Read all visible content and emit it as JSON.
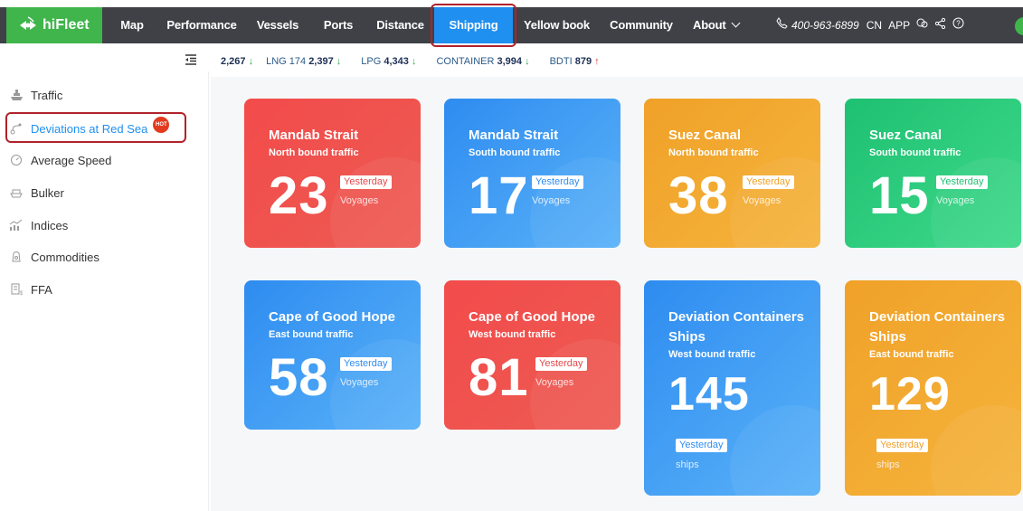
{
  "app": {
    "logo_text": "hiFleet"
  },
  "nav": {
    "items": [
      {
        "label": "Map"
      },
      {
        "label": "Performance"
      },
      {
        "label": "Vessels"
      },
      {
        "label": "Ports"
      },
      {
        "label": "Distance"
      },
      {
        "label": "Shipping"
      },
      {
        "label": "Yellow book"
      },
      {
        "label": "Community"
      },
      {
        "label": "About"
      }
    ],
    "active": "Shipping",
    "phone": "400-963-6899",
    "lang": "CN",
    "app_label": "APP"
  },
  "ticker": [
    {
      "label": "",
      "value": "2,267",
      "dir": "down"
    },
    {
      "label": "LNG 174",
      "value": "2,397",
      "dir": "down"
    },
    {
      "label": "LPG",
      "value": "4,343",
      "dir": "down"
    },
    {
      "label": "CONTAINER",
      "value": "3,994",
      "dir": "down"
    },
    {
      "label": "BDTI",
      "value": "879",
      "dir": "up"
    }
  ],
  "sidebar": {
    "items": [
      {
        "label": "Traffic",
        "icon": "ship-icon"
      },
      {
        "label": "Deviations at Red Sea",
        "icon": "route-icon",
        "badge": "HOT"
      },
      {
        "label": "Average Speed",
        "icon": "speedometer-icon"
      },
      {
        "label": "Bulker",
        "icon": "bulker-icon"
      },
      {
        "label": "Indices",
        "icon": "chart-icon"
      },
      {
        "label": "Commodities",
        "icon": "commodities-icon"
      },
      {
        "label": "FFA",
        "icon": "ffa-icon"
      }
    ],
    "active": "Deviations at Red Sea"
  },
  "cards": [
    {
      "title": "Mandab Strait",
      "subtitle": "North bound traffic",
      "value": "23",
      "tag": "Yesterday",
      "unit": "Voyages",
      "color": "#f24b4b"
    },
    {
      "title": "Mandab Strait",
      "subtitle": "South bound traffic",
      "value": "17",
      "tag": "Yesterday",
      "unit": "Voyages",
      "color": "#2e8cf0"
    },
    {
      "title": "Suez Canal",
      "subtitle": "North bound traffic",
      "value": "38",
      "tag": "Yesterday",
      "unit": "Voyages",
      "color": "#f0a128"
    },
    {
      "title": "Suez Canal",
      "subtitle": "South bound traffic",
      "value": "15",
      "tag": "Yesterday",
      "unit": "Voyages",
      "color": "#1ec072"
    },
    {
      "title": "Cape of Good Hope",
      "subtitle": "East bound traffic",
      "value": "58",
      "tag": "Yesterday",
      "unit": "Voyages",
      "color": "#2e8cf0"
    },
    {
      "title": "Cape of Good Hope",
      "subtitle": "West bound traffic",
      "value": "81",
      "tag": "Yesterday",
      "unit": "Voyages",
      "color": "#f24b4b"
    },
    {
      "title": "Deviation Containers Ships",
      "subtitle": "West bound traffic",
      "value": "145",
      "tag": "Yesterday",
      "unit": "ships",
      "color": "#2e8cf0"
    },
    {
      "title": "Deviation Containers Ships",
      "subtitle": "East bound traffic",
      "value": "129",
      "tag": "Yesterday",
      "unit": "ships",
      "color": "#f0a128"
    }
  ]
}
